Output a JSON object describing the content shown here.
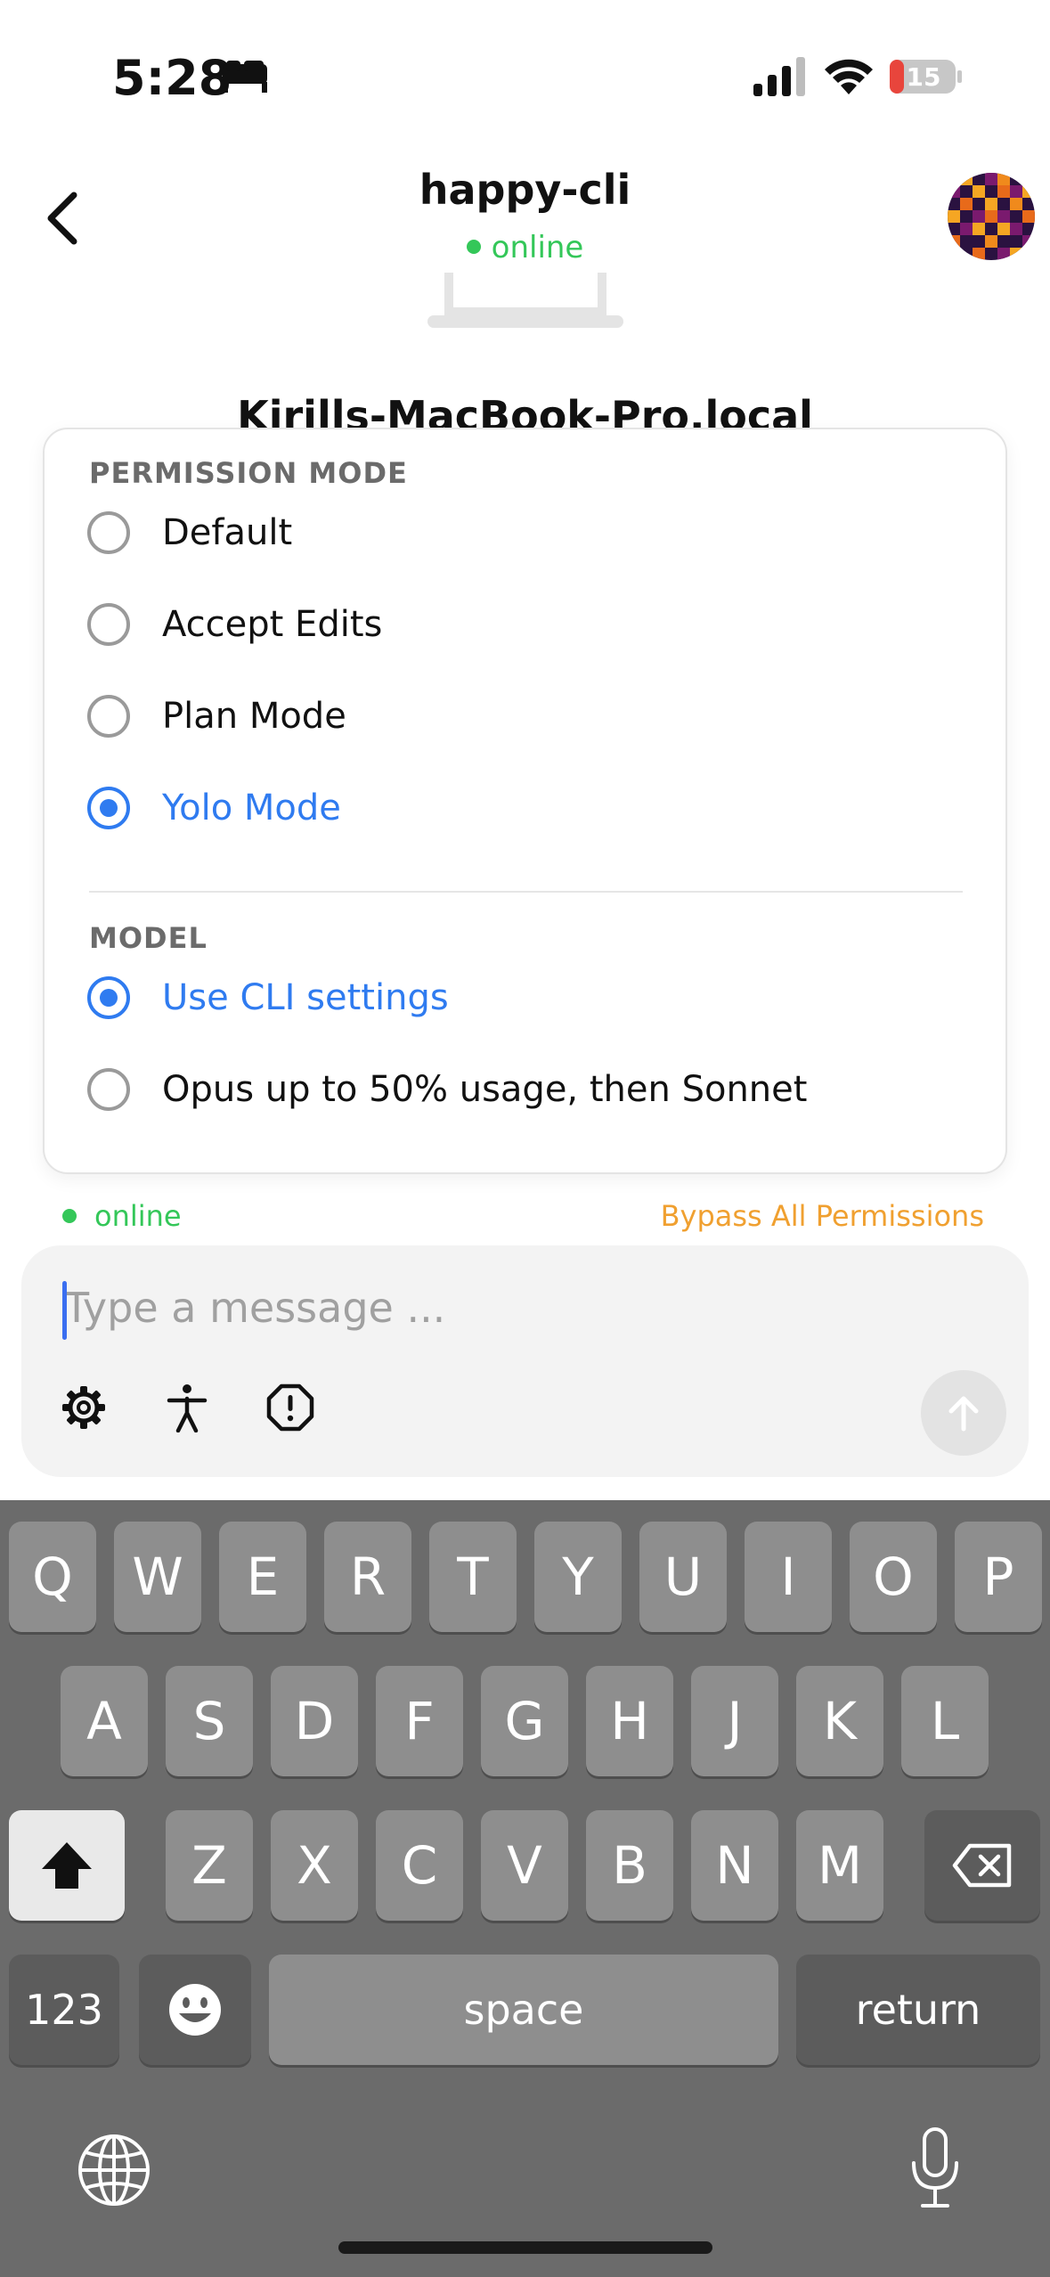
{
  "status_bar": {
    "time": "5:28",
    "battery_level": "15"
  },
  "header": {
    "title": "happy-cli",
    "status": "online"
  },
  "background": {
    "machine_name": "Kirills-MacBook-Pro.local"
  },
  "popup": {
    "permission_section": "PERMISSION MODE",
    "permission_options": [
      {
        "label": "Default",
        "selected": false
      },
      {
        "label": "Accept Edits",
        "selected": false
      },
      {
        "label": "Plan Mode",
        "selected": false
      },
      {
        "label": "Yolo Mode",
        "selected": true
      }
    ],
    "model_section": "MODEL",
    "model_options": [
      {
        "label": "Use CLI settings",
        "selected": true
      },
      {
        "label": "Opus up to 50% usage, then Sonnet",
        "selected": false
      }
    ]
  },
  "status_row": {
    "connection": "online",
    "mode_badge": "Bypass All Permissions"
  },
  "composer": {
    "placeholder": "Type a message ..."
  },
  "keyboard": {
    "row1": [
      "Q",
      "W",
      "E",
      "R",
      "T",
      "Y",
      "U",
      "I",
      "O",
      "P"
    ],
    "row2": [
      "A",
      "S",
      "D",
      "F",
      "G",
      "H",
      "J",
      "K",
      "L"
    ],
    "row3": [
      "Z",
      "X",
      "C",
      "V",
      "B",
      "N",
      "M"
    ],
    "numbers_label": "123",
    "space_label": "space",
    "return_label": "return"
  },
  "colors": {
    "accent": "#2f7bf0",
    "online": "#34c759",
    "warning": "#f0a030"
  }
}
